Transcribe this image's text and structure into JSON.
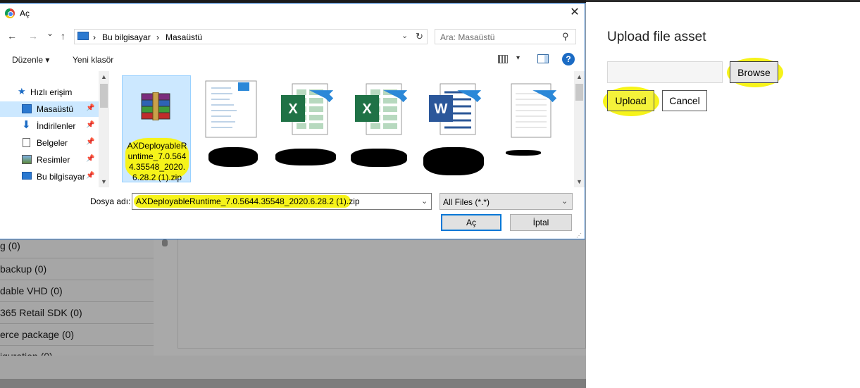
{
  "dialog": {
    "title": "Aç",
    "close_glyph": "✕",
    "nav": {
      "back_glyph": "←",
      "forward_glyph": "→",
      "recent_glyph": "⌄",
      "up_glyph": "↑"
    },
    "address": {
      "sep1": "›",
      "crumb1": "Bu bilgisayar",
      "sep2": "›",
      "crumb2": "Masaüstü",
      "drop_glyph": "⌄",
      "refresh_glyph": "↻"
    },
    "search": {
      "placeholder": "Ara: Masaüstü",
      "icon_glyph": "⚲"
    },
    "toolbar": {
      "organize": "Düzenle ▾",
      "new_folder": "Yeni klasör",
      "view_drop": "▾",
      "help": "?"
    },
    "navpane": {
      "items": [
        {
          "label": "Hızlı erişim",
          "icon": "star-icon"
        },
        {
          "label": "Masaüstü",
          "icon": "desktop-icon",
          "pin": "📌"
        },
        {
          "label": "İndirilenler",
          "icon": "download-icon",
          "pin": "📌"
        },
        {
          "label": "Belgeler",
          "icon": "documents-icon",
          "pin": "📌"
        },
        {
          "label": "Resimler",
          "icon": "pictures-icon",
          "pin": "📌"
        },
        {
          "label": "Bu bilgisayar",
          "icon": "computer-icon",
          "pin": "📌"
        }
      ],
      "scroll_up": "▲",
      "scroll_down": "▼"
    },
    "files": [
      {
        "name": "AXDeployableRuntime_7.0.5644.35548_2020.6.28.2 (1).zip",
        "icon": "winrar-archive-icon"
      },
      {
        "name": "",
        "icon": "text-document-icon"
      },
      {
        "name": "",
        "icon": "excel-shortcut-icon",
        "letter": "X"
      },
      {
        "name": "",
        "icon": "excel-shortcut-icon",
        "letter": "X"
      },
      {
        "name": "",
        "icon": "word-shortcut-icon",
        "letter": "W"
      },
      {
        "name": "",
        "icon": "blank-document-shortcut-icon"
      }
    ],
    "filename_label": "Dosya adı:",
    "filename_value": "AXDeployableRuntime_7.0.5644.35548_2020.6.28.2 (1).zip",
    "filename_drop": "⌄",
    "filetype_value": "All Files (*.*)",
    "filetype_drop": "⌄",
    "open_label": "Aç",
    "cancel_label": "İptal",
    "grip_glyph": "⋰"
  },
  "background": {
    "rows": [
      "g (0)",
      " backup (0)",
      "dable VHD (0)",
      " 365 Retail SDK (0)",
      "erce package (0)",
      "iguration (0)"
    ]
  },
  "flyout": {
    "title": "Upload file asset",
    "browse_label": "Browse",
    "upload_label": "Upload",
    "cancel_label": "Cancel"
  },
  "colors": {
    "highlight": "#f6f31a",
    "accent": "#0078d7",
    "selection": "#cce8ff"
  }
}
